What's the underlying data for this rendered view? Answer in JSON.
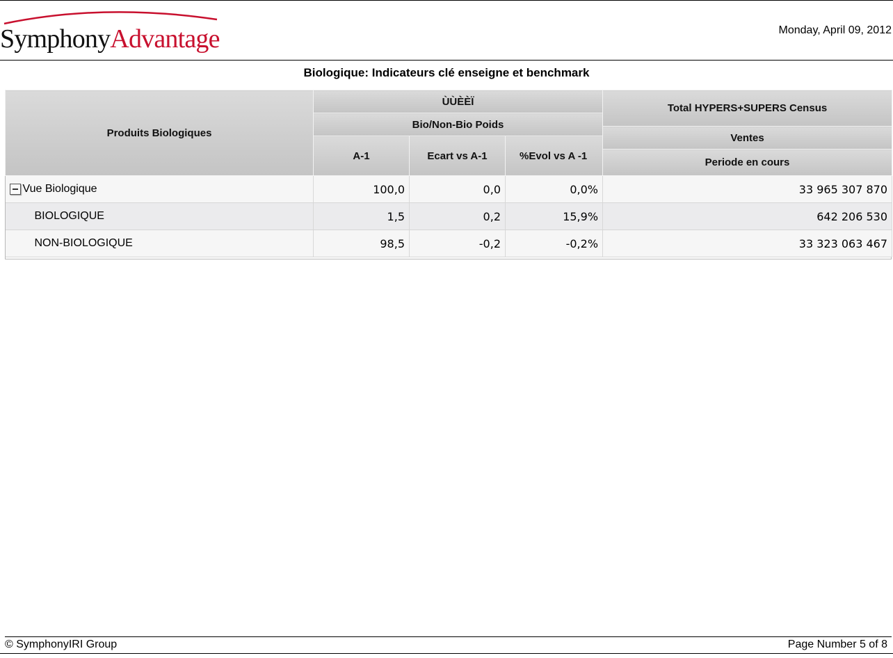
{
  "header": {
    "brand_part1": "Symphony",
    "brand_part2": "Advantage",
    "date": "Monday, April 09, 2012",
    "title": "Biologique: Indicateurs clé enseigne et benchmark",
    "brand_arc_color": "#c8102e"
  },
  "grid": {
    "row_header": "Produits Biologiques",
    "group1": "ÙÙÈÈÏ",
    "group1_sub": "Bio/Non-Bio Poids",
    "col_a1": "A-1",
    "col_ecart": "Ecart vs A-1",
    "col_evol": "%Evol vs A -1",
    "group2": "Total HYPERS+SUPERS Census",
    "group2_sub": "Ventes",
    "col_periode": "Periode en cours",
    "rows": [
      {
        "label": "Vue Biologique",
        "a1": "100,0",
        "ecart": "0,0",
        "evol": "0,0%",
        "ventes": "33 965 307 870"
      },
      {
        "label": "BIOLOGIQUE",
        "a1": "1,5",
        "ecart": "0,2",
        "evol": "15,9%",
        "ventes": "642 206 530"
      },
      {
        "label": "NON-BIOLOGIQUE",
        "a1": "98,5",
        "ecart": "-0,2",
        "evol": "-0,2%",
        "ventes": "33 323 063 467"
      }
    ]
  },
  "footer": {
    "copyright": "© SymphonyIRI Group",
    "page": "Page Number 5 of 8"
  }
}
